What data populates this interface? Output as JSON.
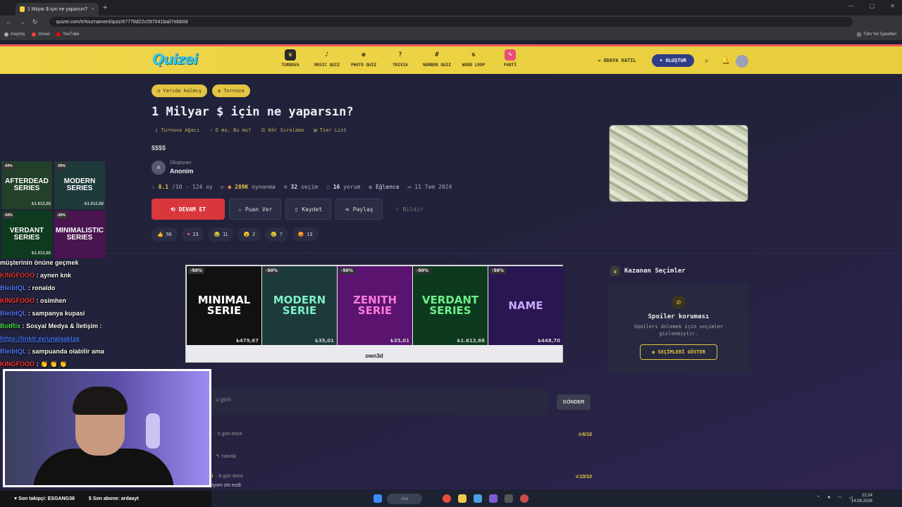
{
  "browser": {
    "tab_title": "1 Milyar $ için ne yaparsın? - Tur",
    "new_tab": "+",
    "url": "quizei.com/tr/tournament/quiz/67778d22c097041ba07ebb0d",
    "bookmarks": [
      "Geçmiş",
      "Gmail",
      "YouTube"
    ],
    "all_bookmarks": "Tüm Yer İşaretleri"
  },
  "header": {
    "logo": "Quizei",
    "nav": [
      {
        "label": "TURNUVA",
        "icon": "♛"
      },
      {
        "label": "MUSIC QUIZ",
        "icon": "♪"
      },
      {
        "label": "PHOTO QUIZ",
        "icon": "◉"
      },
      {
        "label": "TRIVIA",
        "icon": "?"
      },
      {
        "label": "NUMBER QUIZ",
        "icon": "#"
      },
      {
        "label": "WORD LOOP",
        "icon": "⇅"
      },
      {
        "label": "PARTİ",
        "icon": "✎"
      }
    ],
    "join_room": "ODAYA KATIL",
    "create": "+ OLUŞTUR"
  },
  "quiz": {
    "badge_unfinished": "Yarıda kalmış",
    "badge_tournament": "Turnuva",
    "title": "1 Milyar $ için ne yaparsın?",
    "sublinks": [
      "Turnuva Ağacı",
      "O mu, Bu mu?",
      "Kör Sıralama",
      "Tier List"
    ],
    "description": "$$$$",
    "creator_label": "Oluşturan",
    "creator_name": "Anonim",
    "creator_initial": "A",
    "rating": "8.1",
    "rating_meta": "/10 · 124 oy",
    "plays": "289K",
    "plays_label": "oynanma",
    "choices": "32",
    "choices_label": "seçim",
    "comments_count": "16",
    "comments_label": "yorum",
    "category": "Eğlence",
    "date": "11 Tem 2024",
    "btn_continue": "DEVAM ET",
    "btn_rate": "Puan Ver",
    "btn_save": "Kaydet",
    "btn_share": "Paylaş",
    "btn_report": "Bildir",
    "reactions": [
      {
        "icon": "👍",
        "count": "58"
      },
      {
        "icon": "♥",
        "count": "23"
      },
      {
        "icon": "😂",
        "count": "11"
      },
      {
        "icon": "😮",
        "count": "2"
      },
      {
        "icon": "😢",
        "count": "7"
      },
      {
        "icon": "😡",
        "count": "13"
      }
    ]
  },
  "ad": {
    "brand": "own3d",
    "items": [
      {
        "name": "MINIMAL\nSERIE",
        "off": "-50%",
        "price": "₺479,67",
        "bg": "#111111",
        "fg": "#ffffff"
      },
      {
        "name": "MODERN\nSERIE",
        "off": "-50%",
        "price": "₺35,01",
        "bg": "#1d3a3a",
        "fg": "#7ef0c8"
      },
      {
        "name": "ZENITH\nSERIE",
        "off": "-50%",
        "price": "₺35,01",
        "bg": "#5a1470",
        "fg": "#ff7ad9"
      },
      {
        "name": "VERDANT\nSERIES",
        "off": "-50%",
        "price": "₺1.612,68",
        "bg": "#0d3a1e",
        "fg": "#6ef08a"
      },
      {
        "name": "NAME",
        "off": "-50%",
        "price": "₺448,70",
        "bg": "#2a1650",
        "fg": "#c9a8ff"
      }
    ]
  },
  "winners": {
    "title": "Kazanan Seçimler",
    "spoiler_title": "Spoiler koruması",
    "spoiler_text": "Spoilerı önlemek için seçimler gizlenmiştir.",
    "show_button": "SEÇİMLERİ GÖSTER"
  },
  "comments": {
    "placeholder": "u girin",
    "send": "GÖNDER",
    "items": [
      {
        "user": "ir",
        "time": "5 gün önce",
        "score": "☆6/10",
        "reply": "↰ Yanıtla"
      },
      {
        "user": "ni",
        "time": "6 gün önce",
        "score": "☆10/10",
        "text": "içiyom ztn ezdi"
      }
    ]
  },
  "overlay": {
    "tiles": [
      {
        "name": "AFTERDEAD\nSERIES",
        "off": "-50%",
        "price": "₺1.612,68",
        "bg": "#23402a"
      },
      {
        "name": "MODERN\nSERIES",
        "off": "-50%",
        "price": "₺1.612,68",
        "bg": "#1e3a3a"
      },
      {
        "name": "VERDANT\nSERIES",
        "off": "-50%",
        "price": "₺1.612,68",
        "bg": "#0e3a20"
      },
      {
        "name": "MINIMALISTIC\nSERIES",
        "off": "-50%",
        "price": "",
        "bg": "#4a1450"
      }
    ],
    "chat": [
      {
        "name": "",
        "msg": "müşterinin önüne geçmek"
      },
      {
        "name": "KINGFOOO",
        "msg": ": aynen knk",
        "cls": "n1"
      },
      {
        "name": "BleibtQL",
        "msg": ": ronaldo",
        "cls": "n2"
      },
      {
        "name": "KINGFOOO",
        "msg": ": osimhen",
        "cls": "n3"
      },
      {
        "name": "BleibtQL",
        "msg": ": sampanya kupasi",
        "cls": "n2"
      },
      {
        "name": "BotRix",
        "msg": ": Sosyal Medya & İletişim :",
        "cls": "bot"
      },
      {
        "name": "",
        "msg": "https://linktr.ee/unalaaktas",
        "cls": "link"
      },
      {
        "name": "BleibtQL",
        "msg": ": sampuanda olabilir ama",
        "cls": "n2"
      },
      {
        "name": "KINGFOOO",
        "msg": ": 👏 👏 👏",
        "cls": "n3"
      }
    ],
    "last_follower": "Son takipçi: ESGANG38",
    "last_sub": "Son abone: ardaayt"
  },
  "taskbar": {
    "search": "Ara",
    "time": "22:24",
    "date": "14.08.2026"
  }
}
